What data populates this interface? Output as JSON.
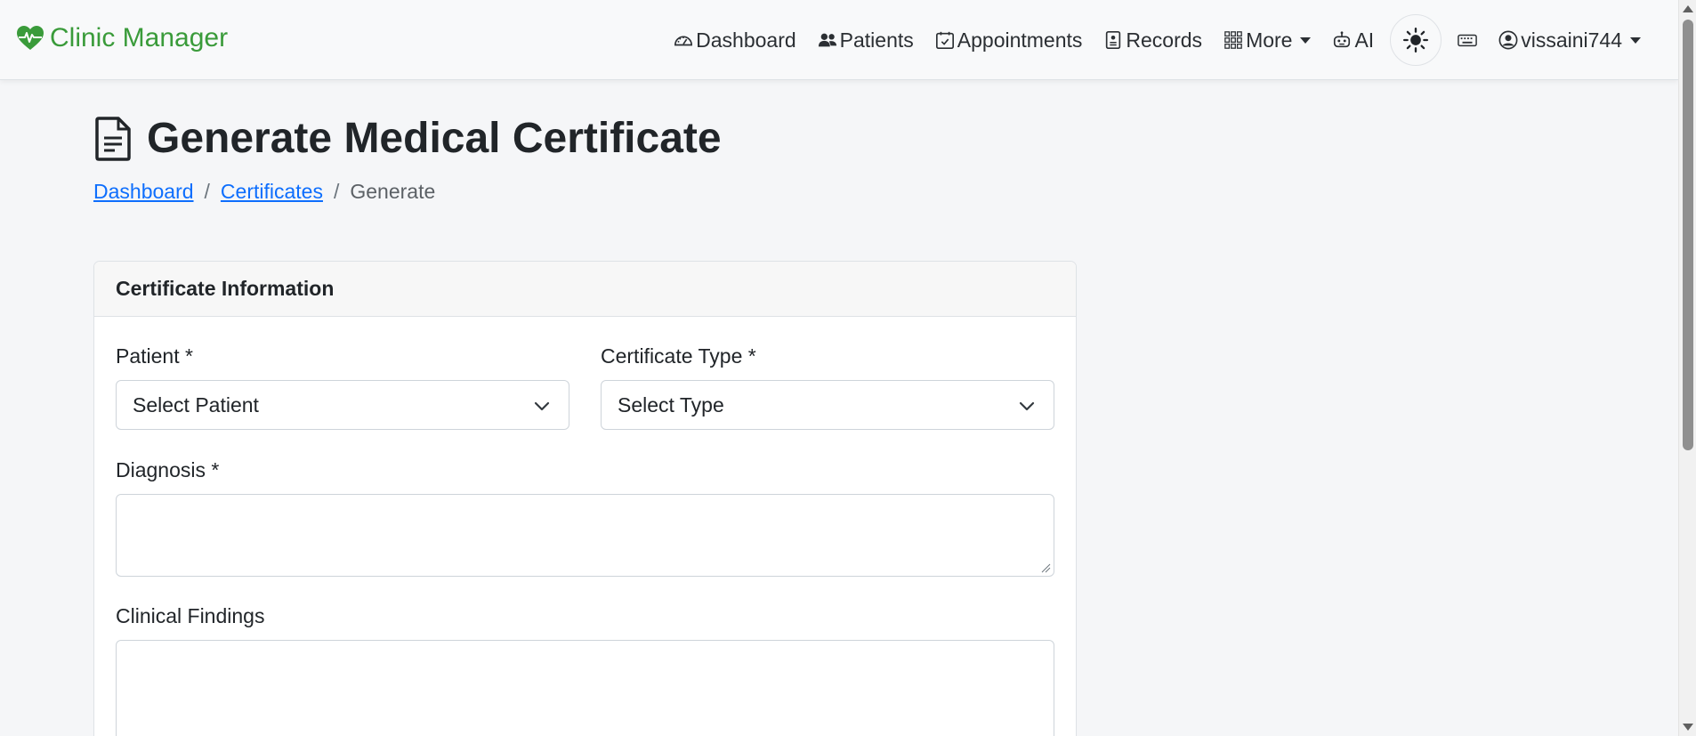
{
  "brand": {
    "name": "Clinic Manager",
    "icon": "heart-pulse-icon",
    "color": "#3a9b3a"
  },
  "nav": {
    "dashboard": "Dashboard",
    "patients": "Patients",
    "appointments": "Appointments",
    "records": "Records",
    "more": "More",
    "ai": "AI",
    "user": "vissaini744"
  },
  "page": {
    "title": "Generate Medical Certificate",
    "title_icon": "file-text-icon"
  },
  "breadcrumb": {
    "items": [
      "Dashboard",
      "Certificates"
    ],
    "current": "Generate",
    "separator": "/"
  },
  "card": {
    "header": "Certificate Information",
    "fields": {
      "patient": {
        "label": "Patient *",
        "value": "Select Patient"
      },
      "certificate_type": {
        "label": "Certificate Type *",
        "value": "Select Type"
      },
      "diagnosis": {
        "label": "Diagnosis *",
        "value": ""
      },
      "clinical_findings": {
        "label": "Clinical Findings",
        "value": ""
      }
    }
  },
  "colors": {
    "link": "#0d6efd",
    "accent": "#3a9b3a"
  }
}
